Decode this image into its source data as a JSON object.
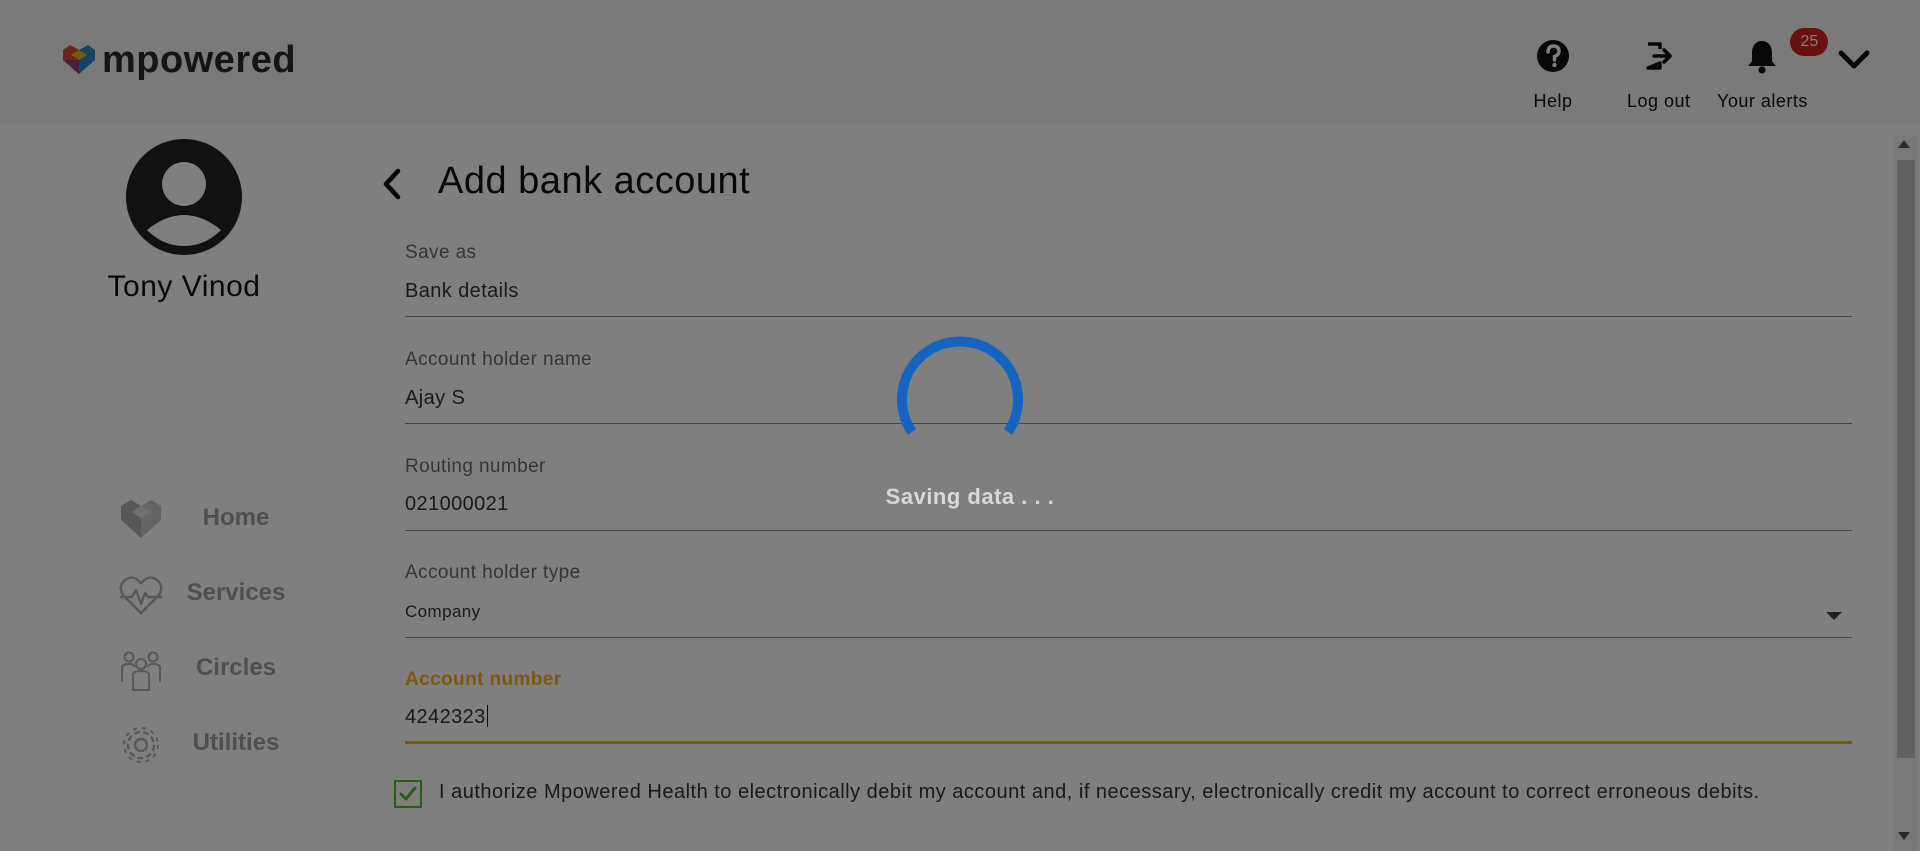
{
  "header": {
    "brand": "mpowered",
    "help_label": "Help",
    "logout_label": "Log out",
    "alerts_label": "Your alerts",
    "alerts_count": "25"
  },
  "sidebar": {
    "user_name": "Tony Vinod",
    "items": [
      {
        "label": "Home",
        "icon": "heart-logo-icon"
      },
      {
        "label": "Services",
        "icon": "heart-pulse-icon"
      },
      {
        "label": "Circles",
        "icon": "people-group-icon"
      },
      {
        "label": "Utilities",
        "icon": "gear-icon"
      }
    ]
  },
  "main": {
    "title": "Add bank account",
    "fields": {
      "save_as": {
        "label": "Save as",
        "value": "Bank details"
      },
      "holder_name": {
        "label": "Account holder name",
        "value": "Ajay S"
      },
      "routing": {
        "label": "Routing number",
        "value": "021000021"
      },
      "holder_type": {
        "label": "Account holder type",
        "value": "Company"
      },
      "account_number": {
        "label": "Account number",
        "value": "4242323"
      }
    },
    "consent": {
      "checked": true,
      "text": "I authorize Mpowered Health to electronically debit my account and, if necessary, electronically credit my account to correct erroneous debits."
    }
  },
  "overlay": {
    "message": "Saving data . . ."
  },
  "colors": {
    "accent": "#f2b21b",
    "spinner": "#1565c0",
    "badge": "#d32020",
    "checkbox": "#55b82a"
  }
}
